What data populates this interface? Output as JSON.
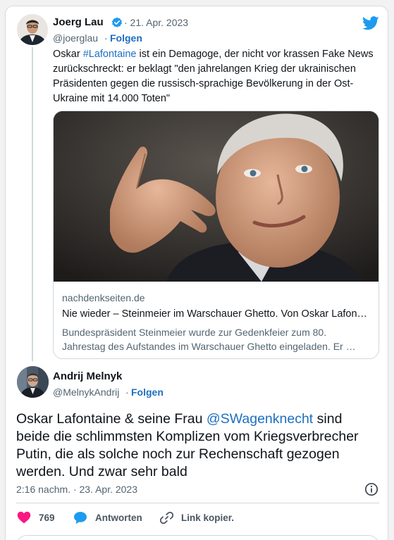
{
  "quoted_tweet": {
    "author_name": "Joerg Lau",
    "date": "· 21. Apr. 2023",
    "handle": "@joerglau",
    "separator": "·",
    "follow_label": "Folgen",
    "text_before_hashtag": "Oskar ",
    "hashtag": "#Lafontaine",
    "text_line1_rest": " ist ein Demagoge, der nicht  vor krassen Fake News",
    "text_line2": "zurückschreckt: er beklagt \"den jahrelangen Krieg der ukrainischen",
    "text_line3": "Präsidenten gegen die russisch-sprachige Bevölkerung in der Ost-",
    "text_line4": "Ukraine mit 14.000 Toten\"",
    "link_card": {
      "domain": "nachdenkseiten.de",
      "title": "Nie wieder – Steinmeier im Warschauer Ghetto. Von Oskar Lafon…",
      "desc_line1": "Bundespräsident Steinmeier wurde zur Gedenkfeier zum 80.",
      "desc_line2": "Jahrestag des Aufstandes im Warschauer Ghetto eingeladen. Er …"
    }
  },
  "main_tweet": {
    "author_name": "Andrij Melnyk",
    "handle": "@MelnykAndrij",
    "separator": "·",
    "follow_label": "Folgen",
    "text_line1_a": "Oskar Lafontaine & seine Frau  ",
    "mention": "@SWagenknecht",
    "text_line1_b": " sind",
    "text_line2": "beide die schlimmsten Komplizen vom Kriegsverbrecher",
    "text_line3": "Putin, die als solche noch zur Rechenschaft gezogen",
    "text_line4": "werden. Und zwar sehr bald",
    "timestamp": "2:16 nachm. · 23. Apr. 2023"
  },
  "actions": {
    "like_count": "769",
    "reply_label": "Antworten",
    "copy_link_label": "Link kopier."
  },
  "colors": {
    "twitter_blue": "#1d9bf0",
    "link_blue": "#1d6fc2",
    "like_pink": "#f91880",
    "muted": "#536471"
  },
  "icons": [
    "verified-badge-icon",
    "twitter-bird-icon",
    "info-icon",
    "heart-icon",
    "reply-bubble-icon",
    "link-icon"
  ]
}
